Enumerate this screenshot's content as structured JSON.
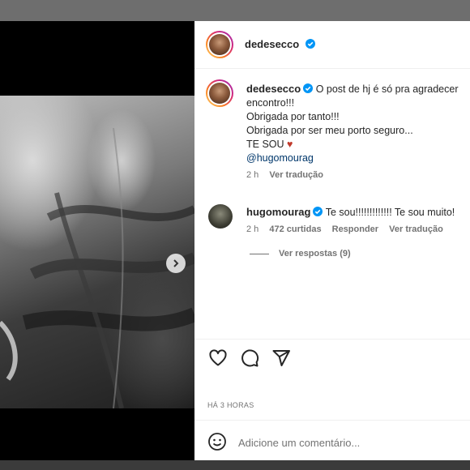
{
  "post": {
    "author": "dedesecco",
    "caption_lines": [
      "O post de hj é só pra agradecer",
      "encontro!!!",
      "Obrigada por tanto!!!",
      "Obrigada por ser meu porto seguro...",
      "TE SOU"
    ],
    "caption_emoji": "♥",
    "caption_mention": "@hugomourag",
    "caption_time": "2 h",
    "caption_translate": "Ver tradução",
    "posted_ago": "HÁ 3 HORAS"
  },
  "comment": {
    "author": "hugomourag",
    "text": "Te sou!!!!!!!!!!!!! Te sou muito!",
    "time": "2 h",
    "likes": "472 curtidas",
    "reply": "Responder",
    "translate": "Ver tradução",
    "view_replies": "Ver respostas (9)"
  },
  "composer": {
    "placeholder": "Adicione um comentário..."
  },
  "icons": {
    "verified": "verified-badge-icon",
    "like": "heart-icon",
    "comment": "comment-icon",
    "share": "send-icon",
    "emoji": "emoji-icon",
    "next": "chevron-right-icon"
  },
  "colors": {
    "verified": "#0095f6",
    "heart": "#c0392b",
    "link": "#00376b"
  }
}
